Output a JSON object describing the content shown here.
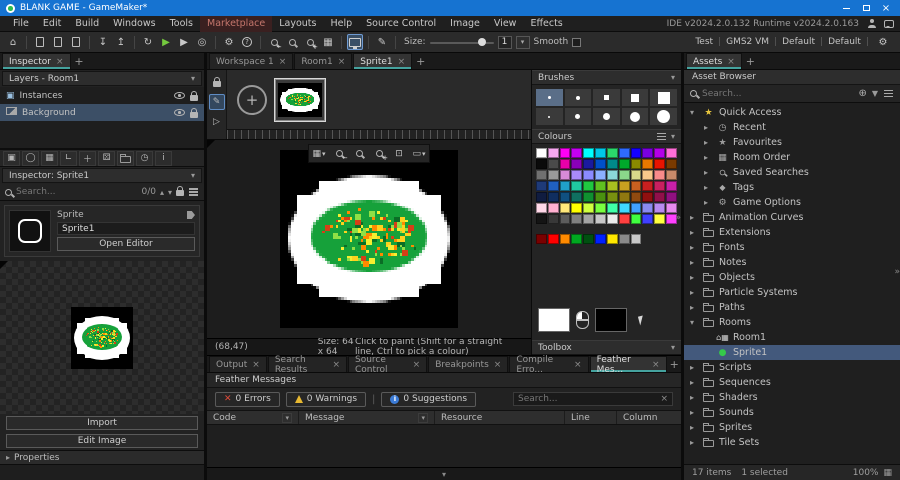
{
  "window": {
    "title": "BLANK GAME - GameMaker*"
  },
  "menubar": {
    "items": [
      {
        "label": "File"
      },
      {
        "label": "Edit"
      },
      {
        "label": "Build"
      },
      {
        "label": "Windows"
      },
      {
        "label": "Tools"
      },
      {
        "label": "Marketplace",
        "cls": "marketplace"
      },
      {
        "label": "Layouts"
      },
      {
        "label": "Help"
      },
      {
        "label": "Source Control"
      },
      {
        "label": "Image"
      },
      {
        "label": "View"
      },
      {
        "label": "Effects"
      }
    ],
    "version_text": "IDE v2024.2.0.132 Runtime v2024.2.0.163"
  },
  "toolbar": {
    "size_label": "Size:",
    "size_value": "1",
    "smooth_label": "Smooth",
    "targets": [
      {
        "label": "Test"
      },
      {
        "label": "GMS2 VM"
      },
      {
        "label": "Default"
      },
      {
        "label": "Default"
      }
    ]
  },
  "inspector_panel": {
    "tab_label": "Inspector",
    "layers_header": "Layers - Room1",
    "layers": [
      {
        "label": "Instances",
        "icon": "instances"
      },
      {
        "label": "Background",
        "icon": "background",
        "cls": "sel"
      }
    ],
    "inspector_header": "Inspector: Sprite1",
    "search_placeholder": "Search...",
    "search_count": "0/0",
    "card": {
      "type": "Sprite",
      "name": "Sprite1",
      "open_editor": "Open Editor"
    },
    "import_label": "Import",
    "edit_image_label": "Edit Image",
    "properties_label": "Properties"
  },
  "doc_tabs": [
    {
      "label": "Workspace 1"
    },
    {
      "label": "Room1"
    },
    {
      "label": "Sprite1",
      "cls": "active"
    }
  ],
  "sprite_editor": {
    "status_coords": "(68,47)",
    "status_size": "Size: 64 x 64",
    "status_hint": "Click to paint (Shift for a straight line, Ctrl to pick a colour)"
  },
  "brushes": {
    "title": "Brushes",
    "cells": [
      {
        "cls": "dot p3",
        "cell": "sel"
      },
      {
        "cls": "dot p4"
      },
      {
        "cls": "sq p5"
      },
      {
        "cls": "sq p8"
      },
      {
        "cls": "sq p12"
      },
      {
        "cls": "dot p2"
      },
      {
        "cls": "cir p5"
      },
      {
        "cls": "cir p7"
      },
      {
        "cls": "cir p10"
      },
      {
        "cls": "cir p13"
      }
    ]
  },
  "colours": {
    "title": "Colours",
    "palette": [
      "#FFFFFF",
      "#F7A8F0",
      "#FF00F6",
      "#C400F0",
      "#00FFFF",
      "#00C8E8",
      "#2BD96B",
      "#2E6BFF",
      "#1400FF",
      "#7A00E0",
      "#B400E8",
      "#FF6FD8",
      "#0A0A0A",
      "#4A4A4A",
      "#E800A8",
      "#8A00B8",
      "#1A1A9E",
      "#0050C8",
      "#008A8A",
      "#00A82B",
      "#8A8A00",
      "#E87800",
      "#E81400",
      "#7A3A00",
      "#707070",
      "#9A9A9A",
      "#D88AD8",
      "#A88AF8",
      "#8A8AFF",
      "#8AB0FF",
      "#8AD8D8",
      "#8AD88A",
      "#D8D88A",
      "#F8C88A",
      "#F88A8A",
      "#C88A6A",
      "#1E3A78",
      "#2060C0",
      "#20A0C8",
      "#20C8A0",
      "#20C840",
      "#60C020",
      "#A8C020",
      "#C8A020",
      "#C86020",
      "#C82020",
      "#C82060",
      "#C820A8",
      "#101C40",
      "#102E60",
      "#105080",
      "#107060",
      "#109030",
      "#4A9010",
      "#789010",
      "#907810",
      "#904A10",
      "#901010",
      "#90104A",
      "#901080",
      "#FFD8E8",
      "#FFB0D0",
      "#FFE87A",
      "#FFFF00",
      "#D0FF40",
      "#7AFF40",
      "#40FFA8",
      "#40D8FF",
      "#40A0FF",
      "#8A8AF0",
      "#B88AF0",
      "#E88AF0",
      "#141414",
      "#383838",
      "#5C5C5C",
      "#808080",
      "#A4A4A4",
      "#C8C8C8",
      "#ECECEC",
      "#FF4040",
      "#40FF40",
      "#4040FF",
      "#FFFF40",
      "#FF40FF"
    ],
    "recent": [
      "#7A0000",
      "#FF0000",
      "#FF8A00",
      "#00A820",
      "#005010",
      "#0020FF",
      "#FFE800",
      "#8A8A8A",
      "#C8C8C8"
    ],
    "left_colour": "#FFFFFF",
    "right_colour": "#000000"
  },
  "toolbox": {
    "title": "Toolbox"
  },
  "feather": {
    "tabs": [
      {
        "label": "Output"
      },
      {
        "label": "Search Results"
      },
      {
        "label": "Source Control"
      },
      {
        "label": "Breakpoints"
      },
      {
        "label": "Compile Erro..."
      },
      {
        "label": "Feather Mes...",
        "cls": "active"
      }
    ],
    "title": "Feather Messages",
    "errors_label": "0 Errors",
    "warnings_label": "0 Warnings",
    "suggestions_label": "0 Suggestions",
    "search_placeholder": "Search...",
    "columns": [
      {
        "label": "Code",
        "cls": "th-code",
        "filt": "filt"
      },
      {
        "label": "Message",
        "cls": "th-msg",
        "filt": "filt"
      },
      {
        "label": "Resource",
        "cls": "th-res"
      },
      {
        "label": "Line",
        "cls": "th-line"
      },
      {
        "label": "Column",
        "cls": "th-col"
      }
    ]
  },
  "assets_panel": {
    "tab_label": "Assets",
    "header": "Asset Browser",
    "search_placeholder": "Search...",
    "tree": [
      {
        "label": "Quick Access",
        "cls": "lv0",
        "twisty": "open",
        "icon": "star-y"
      },
      {
        "label": "Recent",
        "cls": "lv1",
        "twisty": "closed",
        "icon": "clock"
      },
      {
        "label": "Favourites",
        "cls": "lv1",
        "twisty": "closed",
        "icon": "star"
      },
      {
        "label": "Room Order",
        "cls": "lv1",
        "twisty": "closed",
        "icon": "grid"
      },
      {
        "label": "Saved Searches",
        "cls": "lv1",
        "twisty": "closed",
        "icon": "searchi"
      },
      {
        "label": "Tags",
        "cls": "lv1",
        "twisty": "closed",
        "icon": "tag"
      },
      {
        "label": "Game Options",
        "cls": "lv1",
        "twisty": "closed",
        "icon": "gear"
      },
      {
        "label": "Animation Curves",
        "cls": "lv0",
        "twisty": "closed",
        "icon": "folder"
      },
      {
        "label": "Extensions",
        "cls": "lv0",
        "twisty": "closed",
        "icon": "folder"
      },
      {
        "label": "Fonts",
        "cls": "lv0",
        "twisty": "closed",
        "icon": "folder"
      },
      {
        "label": "Notes",
        "cls": "lv0",
        "twisty": "closed",
        "icon": "folder"
      },
      {
        "label": "Objects",
        "cls": "lv0",
        "twisty": "closed",
        "icon": "folder"
      },
      {
        "label": "Particle Systems",
        "cls": "lv0",
        "twisty": "closed",
        "icon": "folder"
      },
      {
        "label": "Paths",
        "cls": "lv0",
        "twisty": "closed",
        "icon": "folder"
      },
      {
        "label": "Rooms",
        "cls": "lv0",
        "twisty": "open",
        "icon": "folder"
      },
      {
        "label": "Room1",
        "cls": "lv1",
        "twisty": "none",
        "icon": "room"
      },
      {
        "label": "Sprite1",
        "cls": "lv1 sel",
        "twisty": "none",
        "icon": "spritei"
      },
      {
        "label": "Scripts",
        "cls": "lv0",
        "twisty": "closed",
        "icon": "folder"
      },
      {
        "label": "Sequences",
        "cls": "lv0",
        "twisty": "closed",
        "icon": "folder"
      },
      {
        "label": "Shaders",
        "cls": "lv0",
        "twisty": "closed",
        "icon": "folder"
      },
      {
        "label": "Sounds",
        "cls": "lv0",
        "twisty": "closed",
        "icon": "folder"
      },
      {
        "label": "Sprites",
        "cls": "lv0",
        "twisty": "closed",
        "icon": "folder"
      },
      {
        "label": "Tile Sets",
        "cls": "lv0",
        "twisty": "closed",
        "icon": "folder"
      }
    ],
    "items_count": "17 items",
    "selected_count": "1 selected",
    "zoom": "100%"
  },
  "sprite_art": {
    "background": "#000000",
    "blob": "#FFFFFF",
    "body": "#16A13A",
    "dark": "#0B6D26",
    "speckles": [
      "#FFD21E",
      "#FF8A00",
      "#D63F17",
      "#8FE045",
      "#F5EE30"
    ]
  }
}
